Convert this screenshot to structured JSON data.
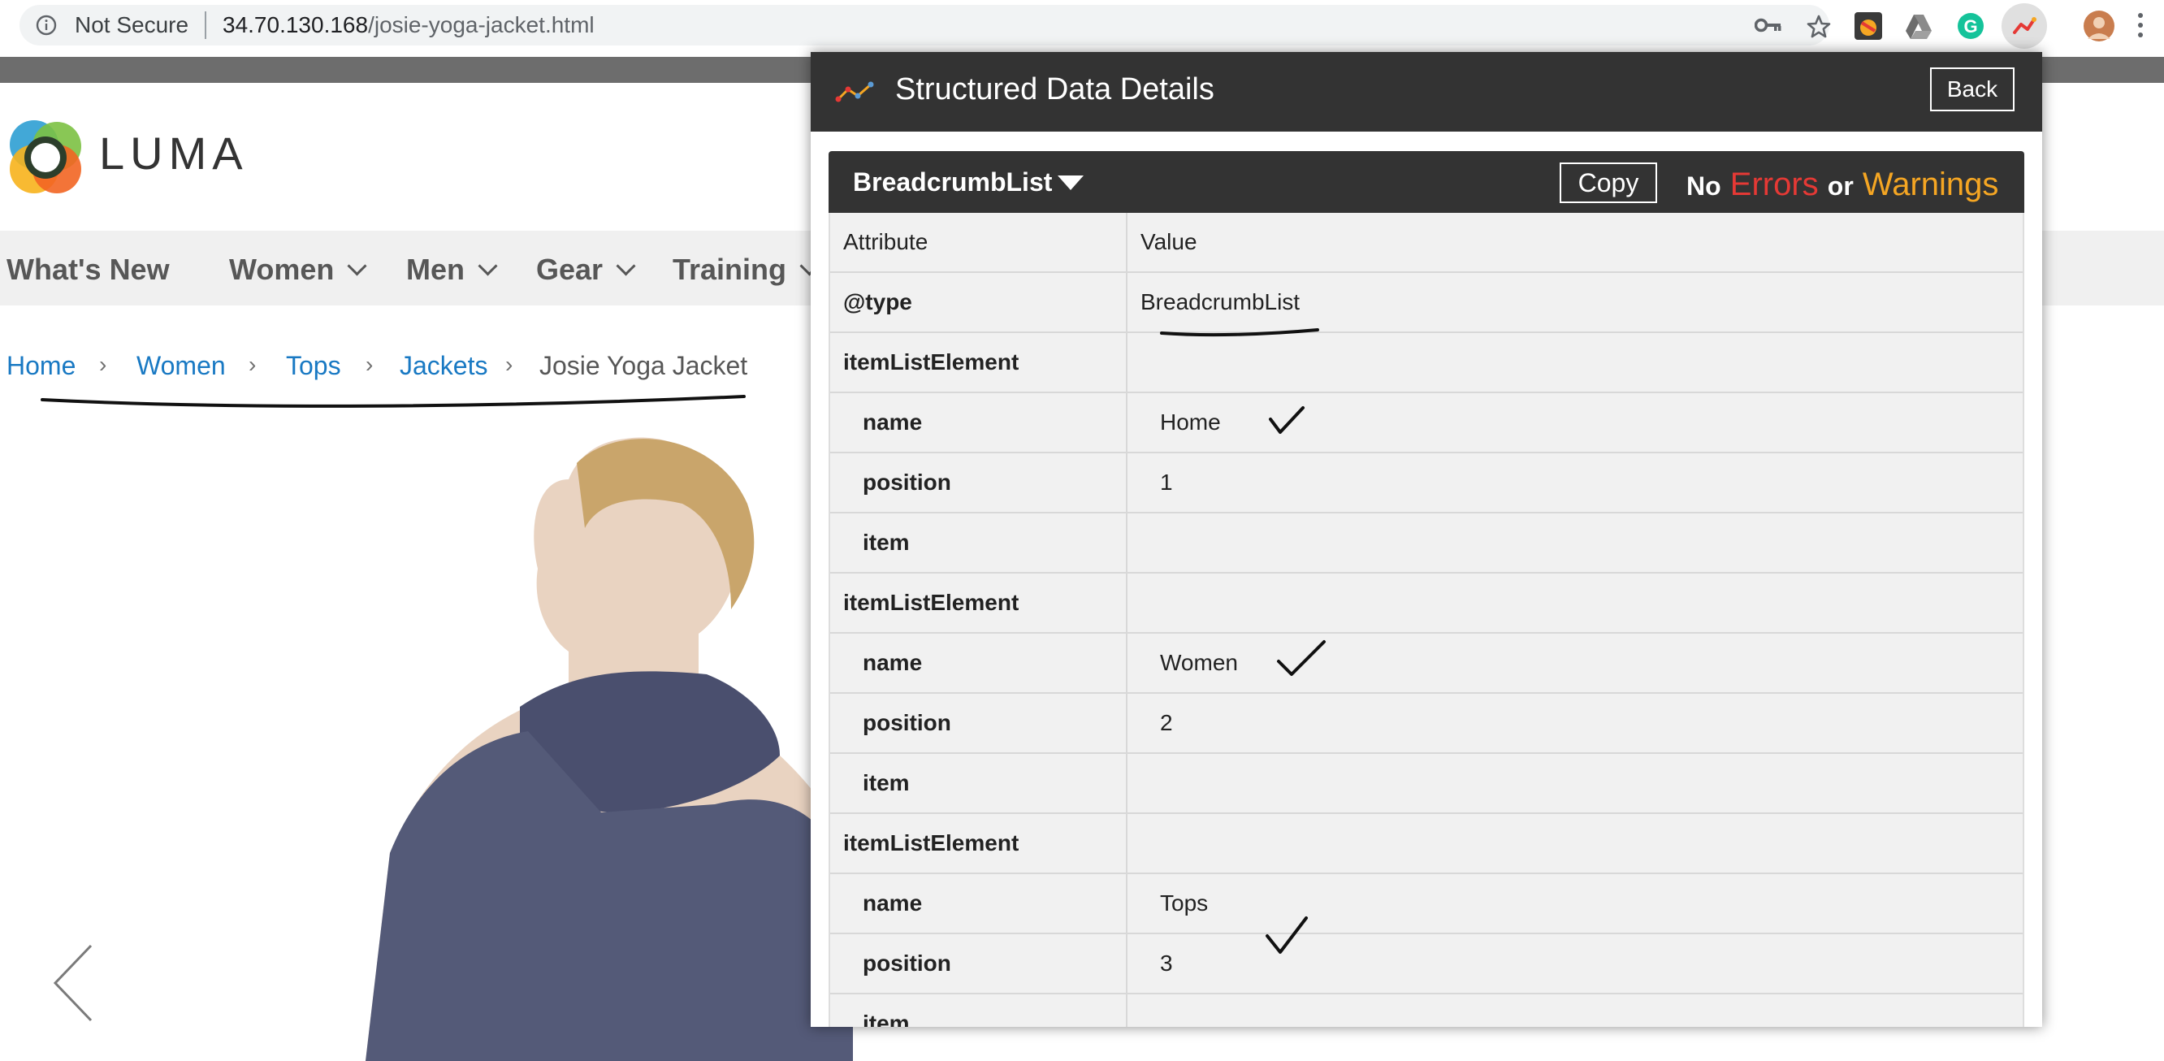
{
  "browser": {
    "security_label": "Not Secure",
    "url_host": "34.70.130.168",
    "url_path": "/josie-yoga-jacket.html",
    "icons": [
      "info-icon",
      "key-icon",
      "star-icon",
      "extension-icon",
      "google-drive-icon",
      "grammarly-icon",
      "structured-data-icon",
      "profile-avatar",
      "menu-icon"
    ]
  },
  "site": {
    "logo_text": "LUMA",
    "nav": [
      "What's New",
      "Women",
      "Men",
      "Gear",
      "Training"
    ],
    "breadcrumbs": [
      "Home",
      "Women",
      "Tops",
      "Jackets",
      "Josie Yoga Jacket"
    ],
    "link_color": "#1979c3"
  },
  "panel": {
    "title": "Structured Data Details",
    "back_label": "Back",
    "type_selected": "BreadcrumbList",
    "copy_label": "Copy",
    "status": {
      "no": "No",
      "errors": "Errors",
      "or": "or",
      "warnings": "Warnings"
    },
    "table_header": {
      "attribute": "Attribute",
      "value": "Value"
    },
    "rows": [
      {
        "attribute": "@type",
        "value": "BreadcrumbList"
      },
      {
        "attribute": "itemListElement",
        "value": ""
      },
      {
        "attribute": "name",
        "value": "Home"
      },
      {
        "attribute": "position",
        "value": "1"
      },
      {
        "attribute": "item",
        "value": ""
      },
      {
        "attribute": "itemListElement",
        "value": ""
      },
      {
        "attribute": "name",
        "value": "Women"
      },
      {
        "attribute": "position",
        "value": "2"
      },
      {
        "attribute": "item",
        "value": ""
      },
      {
        "attribute": "itemListElement",
        "value": ""
      },
      {
        "attribute": "name",
        "value": "Tops"
      },
      {
        "attribute": "position",
        "value": "3"
      },
      {
        "attribute": "item",
        "value": ""
      }
    ],
    "colors": {
      "header_bg": "#333333",
      "errors": "#e53935",
      "warnings": "#f5a623"
    }
  }
}
